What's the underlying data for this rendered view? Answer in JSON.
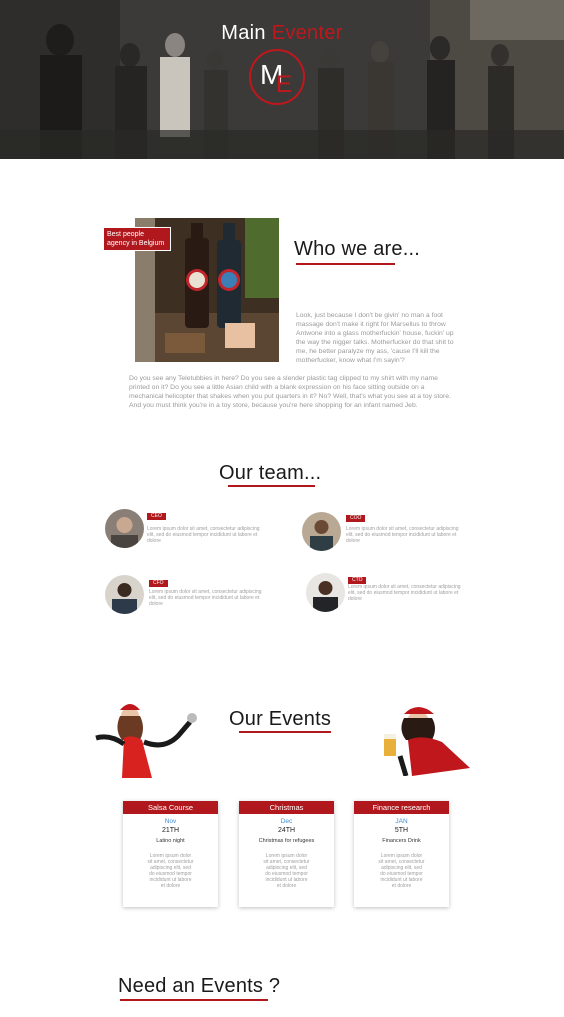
{
  "hero": {
    "title_main": "Main",
    "title_accent": "Eventer",
    "logo_m": "M",
    "logo_e": "E"
  },
  "about": {
    "badge": "Best people agency in Belgium",
    "title": "Who we are...",
    "side_text": "Look, just because I don't be givin' no man a foot massage don't make it right for Marsellus to throw Antwone into a glass motherfuckin' house, fuckin' up the way the nigger talks. Motherfucker do that shit to me, he better paralyze my ass, 'cause I'll kill the motherfucker, know what I'm sayin'?",
    "body_text": "Do you see any Teletubbies in here? Do you see a slender plastic tag clipped to my shirt with my name printed on it? Do you see a little Asian child with a blank expression on his face sitting outside on a mechanical helicopter that shakes when you put quarters in it? No? Well, that's what you see at a toy store. And you must think you're in a toy store, because you're here shopping for an infant named Jeb."
  },
  "team": {
    "title": "Our team...",
    "members": [
      {
        "role": "CEO",
        "text": "Lorem ipsum dolor sit amet, consectetur adipiscing elit, sed do eiusmod tempor incididunt ut labore et dolore"
      },
      {
        "role": "COO",
        "text": "Lorem ipsum dolor sit amet, consectetur adipiscing elit, sed do eiusmod tempor incididunt ut labore et dolore"
      },
      {
        "role": "CFO",
        "text": "Lorem ipsum dolor sit amet, consectetur adipiscing elit, sed do eiusmod tempor incididunt ut labore et dolore"
      },
      {
        "role": "CTO",
        "text": "Lorem ipsum dolor sit amet, consectetur adipiscing elit, sed do eiusmod tempor incididunt ut labore et dolore"
      }
    ]
  },
  "events": {
    "title": "Our Events",
    "cards": [
      {
        "name": "Salsa Course",
        "month": "Nov",
        "day": "21TH",
        "subtitle": "Latino night",
        "desc": "Lorem ipsum dolor sit amet, consectetur adipiscing elit, sed do eiusmod tempor incididunt ut labore et dolore"
      },
      {
        "name": "Christmas",
        "month": "Dec",
        "day": "24TH",
        "subtitle": "Christmas for refugees",
        "desc": "Lorem ipsum dolor sit amet, consectetur adipiscing elit, sed do eiusmod tempor incididunt ut labore et dolore"
      },
      {
        "name": "Finance research",
        "month": "JAN",
        "day": "5TH",
        "subtitle": "Financers Drink",
        "desc": "Lorem ipsum dolor sit amet, consectetur adipiscing elit, sed do eiusmod tempor incididunt ut labore et dolore"
      }
    ]
  },
  "need": {
    "title": "Need an Events ?"
  },
  "colors": {
    "accent": "#b0181d",
    "month_blue": "#3a8fd8"
  }
}
